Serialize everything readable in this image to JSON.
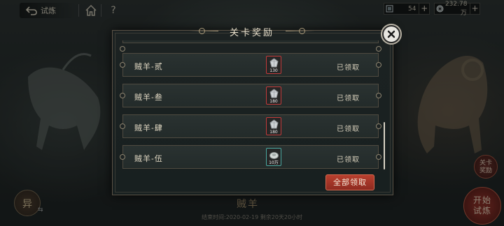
{
  "topbar": {
    "back_label": "试炼",
    "currency": [
      {
        "icon": "jade-icon",
        "value": "54"
      },
      {
        "icon": "coin-icon",
        "value": "232.78万"
      }
    ],
    "plus": "+",
    "help": "?"
  },
  "modal": {
    "title": "关卡奖励",
    "rows": [
      {
        "name": "贼羊-贰",
        "reward_qty": "130",
        "reward_icon": "gem-icon",
        "status": "已领取"
      },
      {
        "name": "贼羊-叁",
        "reward_qty": "180",
        "reward_icon": "gem-icon",
        "status": "已领取"
      },
      {
        "name": "贼羊-肆",
        "reward_qty": "180",
        "reward_icon": "gem-icon",
        "status": "已领取"
      },
      {
        "name": "贼羊-伍",
        "reward_qty": "10万",
        "reward_icon": "silver-icon",
        "status": "已领取"
      }
    ],
    "claim_all_label": "全部领取"
  },
  "background": {
    "stage_name": "贼羊",
    "time_info": "结束时间:2020-02-19  剩余20天20小时",
    "left_button": "异",
    "reward_button": [
      "关卡",
      "奖励"
    ],
    "start_button": [
      "开始",
      "试炼"
    ]
  },
  "colors": {
    "accent_red": "#b8402e",
    "reward_border": "#c23a3a",
    "reward_border_alt": "#4aa8a0"
  }
}
